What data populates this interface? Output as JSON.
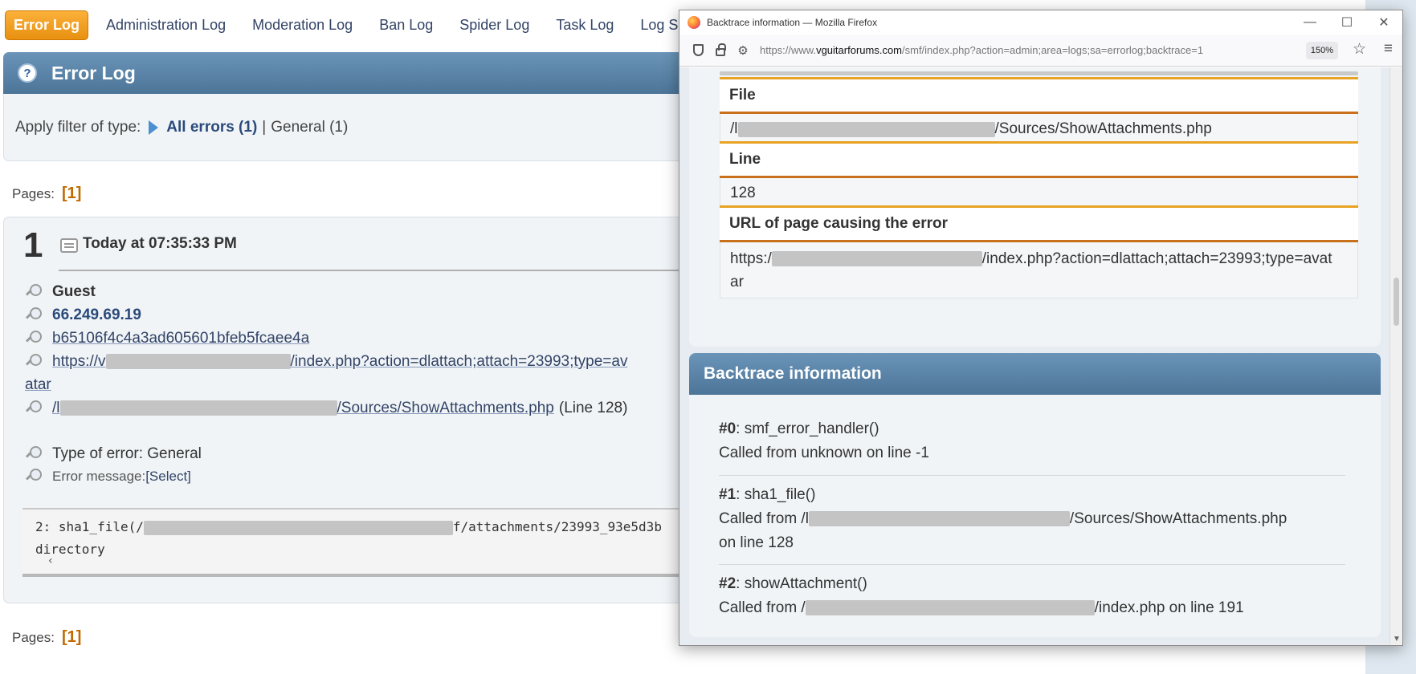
{
  "tabs": [
    "Error Log",
    "Administration Log",
    "Moderation Log",
    "Ban Log",
    "Spider Log",
    "Task Log",
    "Log Se"
  ],
  "colors": {
    "accent": "#f7a42c",
    "header": "#5a84a8",
    "link": "#334466",
    "page_num": "#c06a00"
  },
  "page": {
    "title": "Error Log",
    "filter": {
      "label": "Apply filter of type:",
      "all": "All errors (1)",
      "separator": "|",
      "general": "General (1)"
    },
    "pages_label": "Pages:",
    "pages_value": "[1]"
  },
  "entry": {
    "number": "1",
    "date": "Today at 07:35:33 PM",
    "member": "Guest",
    "ip": "66.249.69.19",
    "session": "b65106f4c4a3ad605601bfeb5fcaee4a",
    "url_start": "https://v",
    "url_end_line1": "/index.php?action=dlattach;attach=23993;type=av",
    "url_line2": "atar",
    "file_start": "/l",
    "file_end": "/Sources/ShowAttachments.php",
    "file_line": "(Line 128)",
    "type_label": "Type of error: General",
    "message_label": "Error message:",
    "message_select": "[Select]",
    "code_line1_start": "2: sha1_file(/",
    "code_line1_end": "f/attachments/23993_93e5d3b",
    "code_line2": "directory",
    "scroll_left": "‹"
  },
  "firefox": {
    "window_title": "Backtrace information — Mozilla Firefox",
    "url_prefix": "https://www.",
    "url_host": "vguitarforums.com",
    "url_path": "/smf/index.php?action=admin;area=logs;sa=errorlog;backtrace=1",
    "zoom": "150%",
    "controls": {
      "minimize": "—",
      "maximize": "☐",
      "close": "✕"
    },
    "details": {
      "file_label": "File",
      "file_start": "/l",
      "file_end": "/Sources/ShowAttachments.php",
      "line_label": "Line",
      "line_value": "128",
      "url_label": "URL of page causing the error",
      "url_start": "https:/",
      "url_end": "/index.php?action=dlattach;attach=23993;type=avat",
      "url_line2": "ar"
    },
    "backtrace": {
      "title": "Backtrace information",
      "items": [
        {
          "id": "#0",
          "func": ": smf_error_handler()",
          "called": "Called from unknown on line -1",
          "called_end": ""
        },
        {
          "id": "#1",
          "func": ": sha1_file()",
          "called": "Called from /l",
          "called_end": "/Sources/ShowAttachments.php",
          "called_line2": "on line 128"
        },
        {
          "id": "#2",
          "func": ": showAttachment()",
          "called": "Called from /",
          "called_end": "/index.php on line 191"
        }
      ]
    }
  }
}
